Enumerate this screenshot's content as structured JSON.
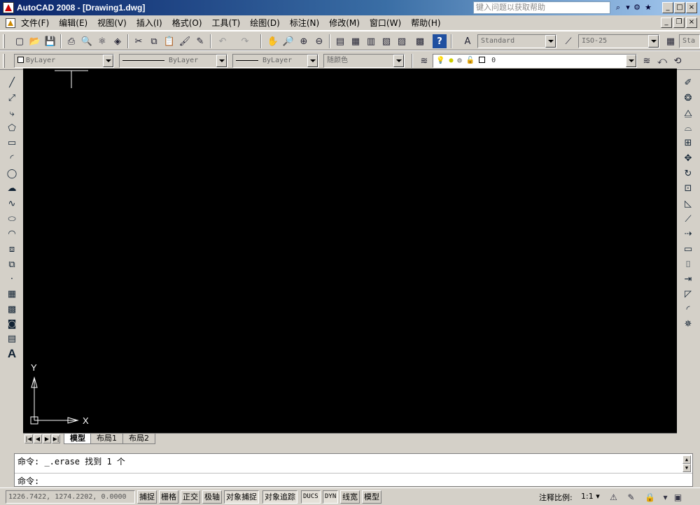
{
  "window": {
    "title": "AutoCAD 2008 - [Drawing1.dwg]",
    "help_placeholder": "键入问题以获取帮助",
    "minimize": "_",
    "maximize": "□",
    "close": "×"
  },
  "menu": {
    "items": [
      "文件(F)",
      "编辑(E)",
      "视图(V)",
      "插入(I)",
      "格式(O)",
      "工具(T)",
      "绘图(D)",
      "标注(N)",
      "修改(M)",
      "窗口(W)",
      "帮助(H)"
    ]
  },
  "toolbar1": {
    "text_style": "Standard",
    "dim_style": "ISO-25",
    "table_style": "Sta"
  },
  "toolbar2": {
    "color": "ByLayer",
    "linetype": "ByLayer",
    "lineweight": "ByLayer",
    "plot_style": "随颜色",
    "layer": "0"
  },
  "canvas": {
    "background": "#000000",
    "ucs_y": "Y",
    "ucs_x": "X"
  },
  "layout_tabs": [
    "模型",
    "布局1",
    "布局2"
  ],
  "command": {
    "history": "命令: _.erase 找到 1 个",
    "prompt": "命令:"
  },
  "status": {
    "coordinates": "1226.7422, 1274.2202, 0.0000",
    "toggles": [
      "捕捉",
      "栅格",
      "正交",
      "极轴",
      "对象捕捉",
      "对象追踪",
      "DUCS",
      "DYN",
      "线宽",
      "模型"
    ],
    "annotation_scale_label": "注释比例:",
    "annotation_scale_value": "1:1 ▾"
  },
  "colors": {
    "title_gradient_start": "#0a246a",
    "chrome": "#d4d0c8",
    "canvas": "#000000"
  }
}
